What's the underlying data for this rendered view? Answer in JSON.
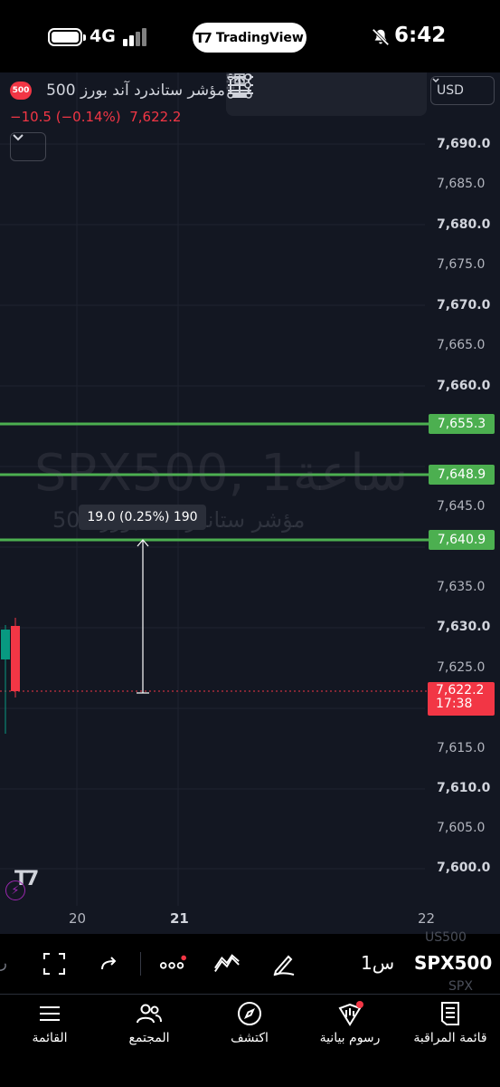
{
  "status_bar": {
    "network": "4G",
    "app_pill": "TradingView",
    "time": "6:42",
    "icons": [
      "battery-icon",
      "signal-icon",
      "bell-off-icon"
    ]
  },
  "chart": {
    "symbol_name": "مؤشر ستاندرد آند بورز 500",
    "symbol_badge": "500",
    "change_text": "−10.5 (−0.14%)",
    "last_price": "7,622.2",
    "currency": "USD",
    "watermark_ticker": "SPX500, 1ساعة",
    "watermark_name": "مؤشر ستاندرد آند بورز 500",
    "measure_label": "19.0 (0.25%) 190",
    "price_tag": {
      "price": "7,622.2",
      "countdown": "17:38"
    },
    "price_axis": [
      {
        "label": "7,690.0",
        "major": true
      },
      {
        "label": "7,685.0",
        "major": false
      },
      {
        "label": "7,680.0",
        "major": true
      },
      {
        "label": "7,675.0",
        "major": false
      },
      {
        "label": "7,670.0",
        "major": true
      },
      {
        "label": "7,665.0",
        "major": false
      },
      {
        "label": "7,660.0",
        "major": true
      },
      {
        "label": "7,645.0",
        "major": false
      },
      {
        "label": "7,635.0",
        "major": false
      },
      {
        "label": "7,630.0",
        "major": true
      },
      {
        "label": "7,625.0",
        "major": false
      },
      {
        "label": "7,615.0",
        "major": false
      },
      {
        "label": "7,610.0",
        "major": true
      },
      {
        "label": "7,605.0",
        "major": false
      },
      {
        "label": "7,600.0",
        "major": true
      }
    ],
    "horizontal_levels": [
      "7,655.3",
      "7,648.9",
      "7,640.9"
    ],
    "time_axis": [
      {
        "label": "20",
        "major": false
      },
      {
        "label": "21",
        "major": true
      },
      {
        "label": "22",
        "major": false
      }
    ],
    "colors": {
      "background": "#131722",
      "level": "#4caf50",
      "down": "#f23645",
      "up": "#089981"
    },
    "draw_tools": [
      "price-label-tool-icon",
      "rectangle-tool-icon",
      "measure-tool-icon",
      "settings-lines-icon"
    ]
  },
  "bottom_toolbar": {
    "edge_glyph": "ر",
    "interval": "1س",
    "ticker": "SPX500",
    "ghost_ticker_a": "US500",
    "ghost_ticker_b": "SPX",
    "icons": [
      "fullscreen-icon",
      "share-arrow-icon",
      "more-dots-icon",
      "indicators-icon",
      "drawing-pen-icon"
    ]
  },
  "bottom_nav": {
    "items": [
      {
        "label": "القائمة",
        "icon": "menu-icon"
      },
      {
        "label": "المجتمع",
        "icon": "community-icon"
      },
      {
        "label": "اكتشف",
        "icon": "compass-icon"
      },
      {
        "label": "رسوم بيانية",
        "icon": "charts-icon"
      },
      {
        "label": "قائمة المراقبة",
        "icon": "watchlist-icon"
      }
    ]
  }
}
